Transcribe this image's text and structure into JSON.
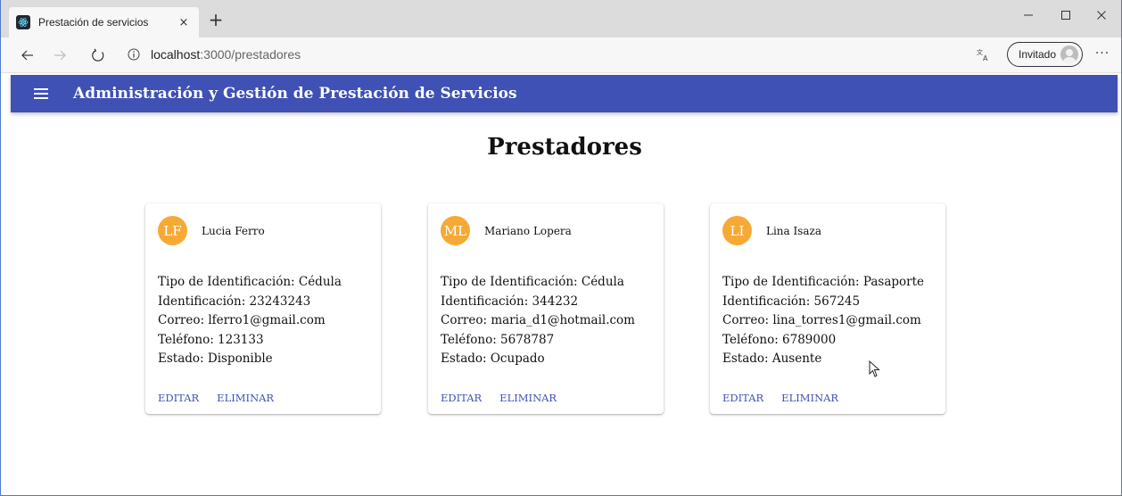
{
  "browser": {
    "tab_title": "Prestación de servicios",
    "tab_close": "×",
    "new_tab": "+",
    "url_host": "localhost",
    "url_path": ":3000/prestadores",
    "profile_label": "Invitado",
    "more": "···"
  },
  "app": {
    "title": "Administración y Gestión de Prestación de Servicios",
    "accent": "#3f51b5",
    "avatar_color": "#f7a935"
  },
  "page": {
    "heading": "Prestadores"
  },
  "cards": [
    {
      "initials": "LF",
      "name": "Lucia Ferro",
      "tipo": "Tipo de Identificación: Cédula",
      "identificacion": "Identificación: 23243243",
      "correo": "Correo: lferro1@gmail.com",
      "telefono": "Teléfono: 123133",
      "estado": "Estado: Disponible",
      "edit_label": "EDITAR",
      "delete_label": "ELIMINAR"
    },
    {
      "initials": "ML",
      "name": "Mariano Lopera",
      "tipo": "Tipo de Identificación: Cédula",
      "identificacion": "Identificación: 344232",
      "correo": "Correo: maria_d1@hotmail.com",
      "telefono": "Teléfono: 5678787",
      "estado": "Estado: Ocupado",
      "edit_label": "EDITAR",
      "delete_label": "ELIMINAR"
    },
    {
      "initials": "LI",
      "name": "Lina Isaza",
      "tipo": "Tipo de Identificación: Pasaporte",
      "identificacion": "Identificación: 567245",
      "correo": "Correo: lina_torres1@gmail.com",
      "telefono": "Teléfono: 6789000",
      "estado": "Estado: Ausente",
      "edit_label": "EDITAR",
      "delete_label": "ELIMINAR"
    }
  ]
}
